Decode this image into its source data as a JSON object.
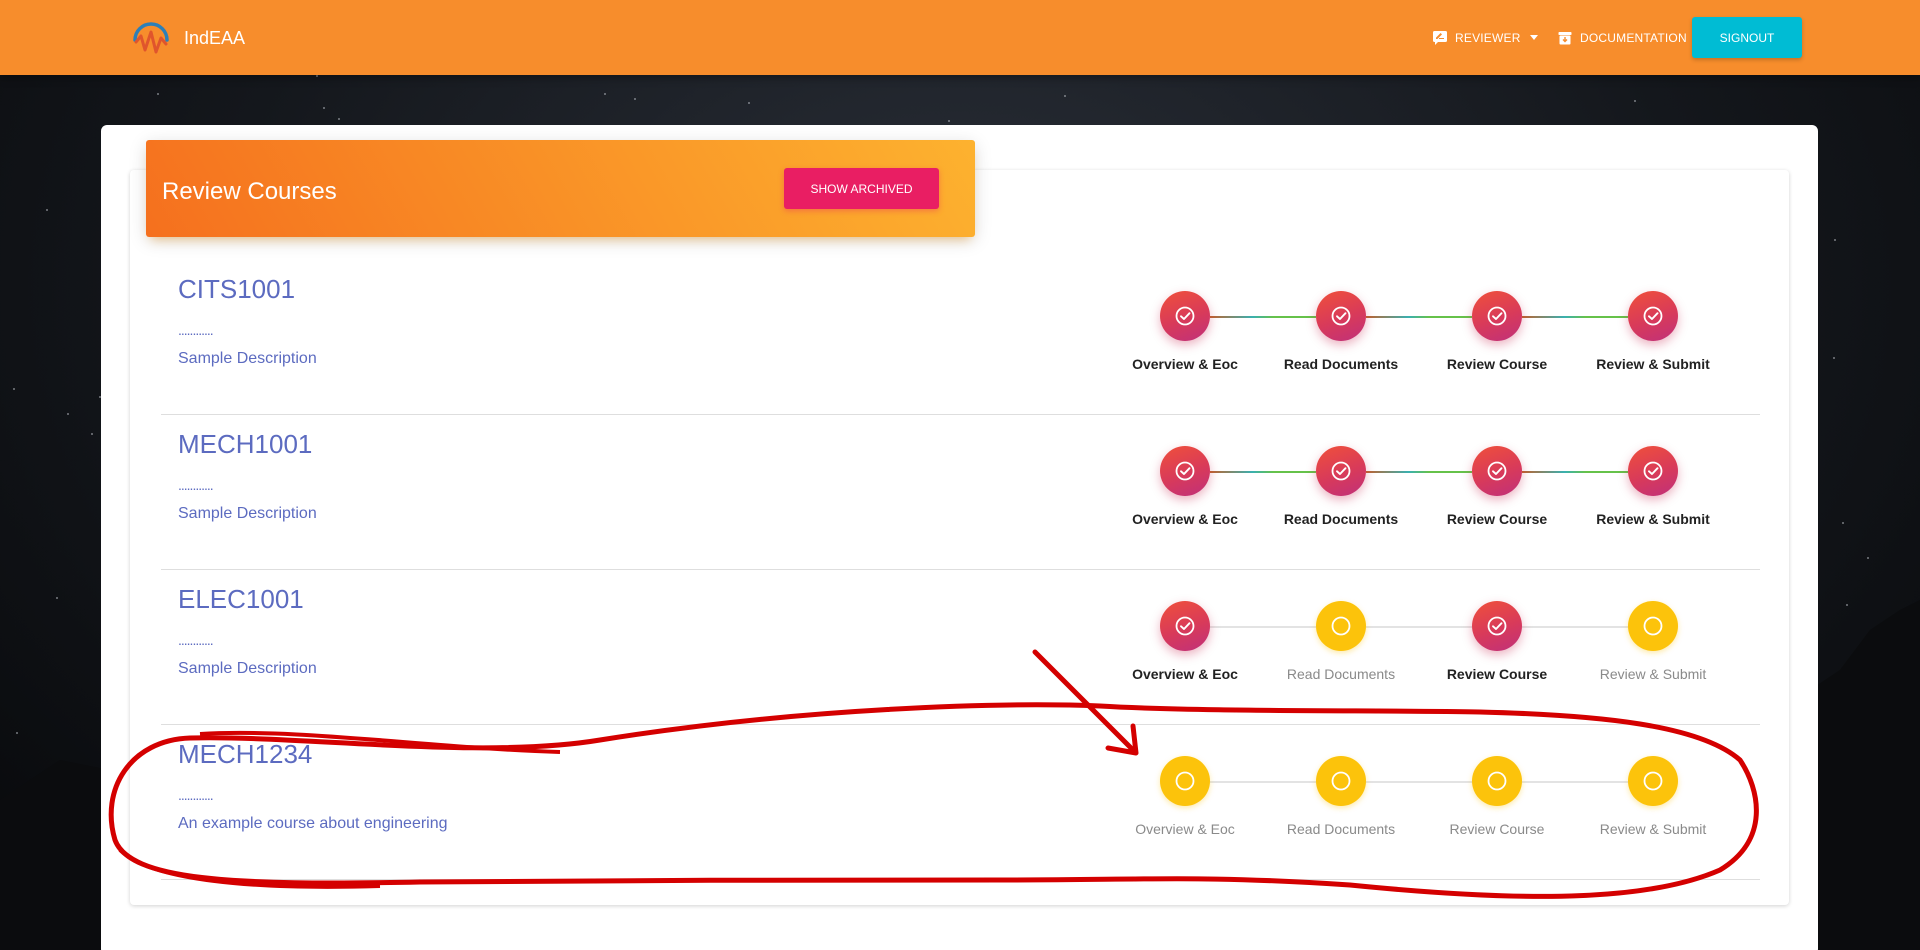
{
  "navbar": {
    "brand": "IndEAA",
    "reviewer_label": "REVIEWER",
    "documentation_label": "DOCUMENTATION",
    "signout_label": "SIGNOUT",
    "background": "#f78d2c"
  },
  "card": {
    "title": "Review Courses",
    "show_archived_label": "SHOW ARCHIVED"
  },
  "step_labels": [
    "Overview & Eoc",
    "Read Documents",
    "Review Course",
    "Review & Submit"
  ],
  "courses": [
    {
      "code": "CITS1001",
      "dots": "............",
      "description": "Sample Description",
      "steps": [
        "done",
        "done",
        "done",
        "done"
      ]
    },
    {
      "code": "MECH1001",
      "dots": "............",
      "description": "Sample Description",
      "steps": [
        "done",
        "done",
        "done",
        "done"
      ]
    },
    {
      "code": "ELEC1001",
      "dots": "............",
      "description": "Sample Description",
      "steps": [
        "done",
        "todo",
        "done",
        "todo"
      ]
    },
    {
      "code": "MECH1234",
      "dots": "............",
      "description": "An example course about engineering",
      "steps": [
        "todo",
        "todo",
        "todo",
        "todo"
      ]
    }
  ],
  "colors": {
    "step_done": "#d83a5a",
    "step_todo": "#fcc30b",
    "accent_link": "#5c6bc0",
    "signout_bg": "#00bcd4",
    "archived_bg": "#e91e63",
    "annotation": "#d40000"
  }
}
